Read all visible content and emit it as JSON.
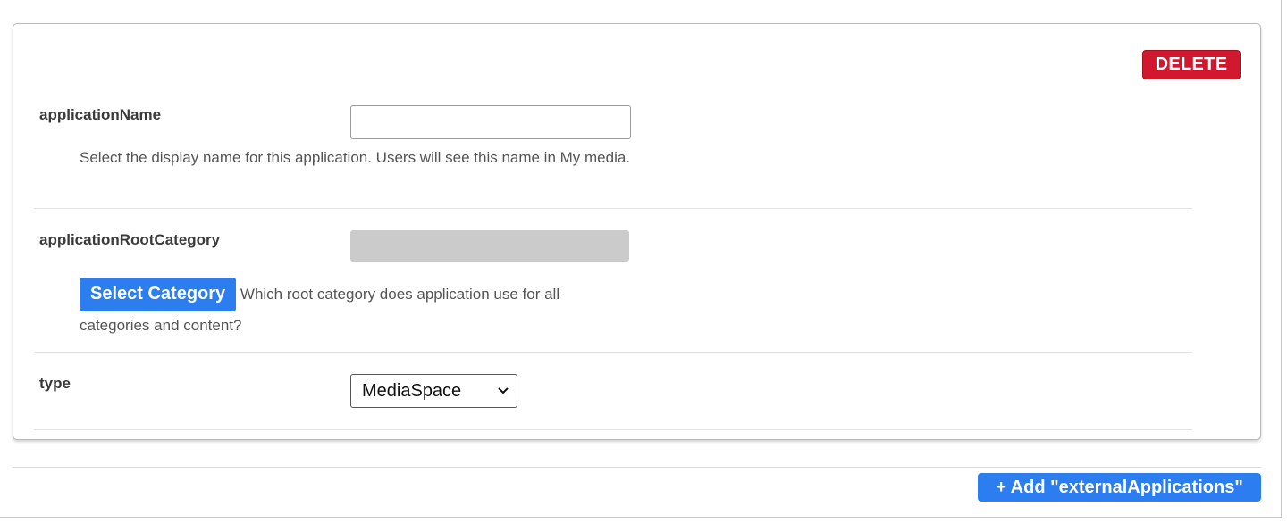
{
  "form": {
    "delete_label": "DELETE",
    "fields": {
      "applicationName": {
        "label": "applicationName",
        "value": "",
        "description": "Select the display name for this application. Users will see this name in My media."
      },
      "applicationRootCategory": {
        "label": "applicationRootCategory",
        "button_label": "Select Category",
        "description": "Which root category does application use for all categories and content?"
      },
      "type": {
        "label": "type",
        "selected": "MediaSpace"
      }
    },
    "add_label": "+ Add \"externalApplications\""
  },
  "colors": {
    "delete": "#d2182e",
    "primary": "#2c7ef0",
    "disabled": "#cbcbcb"
  }
}
